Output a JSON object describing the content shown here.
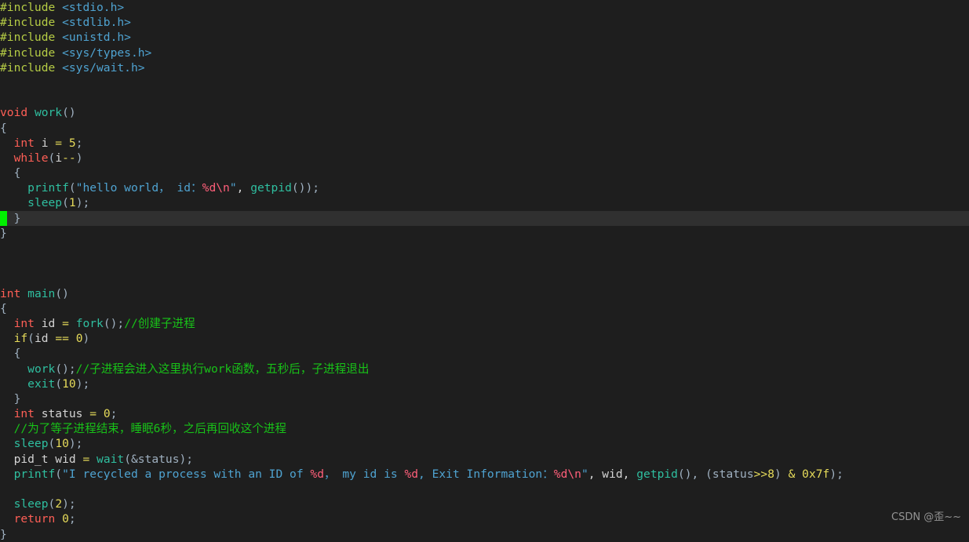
{
  "editor": {
    "background": "#1e1e1e",
    "current_line_background": "#303030",
    "cursor_color": "#00f000",
    "cursor_line_index": 14,
    "cursor_column": 0
  },
  "watermark": {
    "text": "CSDN @歪~~"
  },
  "code": {
    "language": "c",
    "lines": [
      {
        "n": 1,
        "text": "#include <stdio.h>"
      },
      {
        "n": 2,
        "text": "#include <stdlib.h>"
      },
      {
        "n": 3,
        "text": "#include <unistd.h>"
      },
      {
        "n": 4,
        "text": "#include <sys/types.h>"
      },
      {
        "n": 5,
        "text": "#include <sys/wait.h>"
      },
      {
        "n": 6,
        "text": ""
      },
      {
        "n": 7,
        "text": ""
      },
      {
        "n": 8,
        "text": "void work()"
      },
      {
        "n": 9,
        "text": "{"
      },
      {
        "n": 10,
        "text": "  int i = 5;"
      },
      {
        "n": 11,
        "text": "  while(i--)"
      },
      {
        "n": 12,
        "text": "  {"
      },
      {
        "n": 13,
        "text": "    printf(\"hello world， id：%d\\n\", getpid());"
      },
      {
        "n": 14,
        "text": "    sleep(1);"
      },
      {
        "n": 15,
        "text": "  }"
      },
      {
        "n": 16,
        "text": "}"
      },
      {
        "n": 17,
        "text": ""
      },
      {
        "n": 18,
        "text": ""
      },
      {
        "n": 19,
        "text": ""
      },
      {
        "n": 20,
        "text": "int main()"
      },
      {
        "n": 21,
        "text": "{"
      },
      {
        "n": 22,
        "text": "  int id = fork();//创建子进程"
      },
      {
        "n": 23,
        "text": "  if(id == 0)"
      },
      {
        "n": 24,
        "text": "  {"
      },
      {
        "n": 25,
        "text": "    work();//子进程会进入这里执行work函数，五秒后，子进程退出"
      },
      {
        "n": 26,
        "text": "    exit(10);"
      },
      {
        "n": 27,
        "text": "  }"
      },
      {
        "n": 28,
        "text": "  int status = 0;"
      },
      {
        "n": 29,
        "text": "  //为了等子进程结束，睡眠6秒，之后再回收这个进程"
      },
      {
        "n": 30,
        "text": "  sleep(10);"
      },
      {
        "n": 31,
        "text": "  pid_t wid = wait(&status);"
      },
      {
        "n": 32,
        "text": "  printf(\"I recycled a process with an ID of %d， my id is %d, Exit Information：%d\\n\", wid, getpid(), (status>>8) & 0x7f);"
      },
      {
        "n": 33,
        "text": ""
      },
      {
        "n": 34,
        "text": "  sleep(2);"
      },
      {
        "n": 35,
        "text": "  return 0;"
      },
      {
        "n": 36,
        "text": "}"
      }
    ],
    "tokens": {
      "l1": [
        {
          "t": "#include",
          "c": "pre"
        },
        {
          "t": " ",
          "c": "plain"
        },
        {
          "t": "<stdio.h>",
          "c": "hdr"
        }
      ],
      "l2": [
        {
          "t": "#include",
          "c": "pre"
        },
        {
          "t": " ",
          "c": "plain"
        },
        {
          "t": "<stdlib.h>",
          "c": "hdr"
        }
      ],
      "l3": [
        {
          "t": "#include",
          "c": "pre"
        },
        {
          "t": " ",
          "c": "plain"
        },
        {
          "t": "<unistd.h>",
          "c": "hdr"
        }
      ],
      "l4": [
        {
          "t": "#include",
          "c": "pre"
        },
        {
          "t": " ",
          "c": "plain"
        },
        {
          "t": "<sys/types.h>",
          "c": "hdr"
        }
      ],
      "l5": [
        {
          "t": "#include",
          "c": "pre"
        },
        {
          "t": " ",
          "c": "plain"
        },
        {
          "t": "<sys/wait.h>",
          "c": "hdr"
        }
      ],
      "l6": [],
      "l7": [],
      "l8": [
        {
          "t": "void",
          "c": "kw"
        },
        {
          "t": " ",
          "c": "plain"
        },
        {
          "t": "work",
          "c": "fn"
        },
        {
          "t": "()",
          "c": "punct"
        }
      ],
      "l9": [
        {
          "t": "{",
          "c": "punct"
        }
      ],
      "l10": [
        {
          "t": "  ",
          "c": "plain"
        },
        {
          "t": "int",
          "c": "kw"
        },
        {
          "t": " i ",
          "c": "plain"
        },
        {
          "t": "=",
          "c": "op"
        },
        {
          "t": " ",
          "c": "plain"
        },
        {
          "t": "5",
          "c": "num"
        },
        {
          "t": ";",
          "c": "punct"
        }
      ],
      "l11": [
        {
          "t": "  ",
          "c": "plain"
        },
        {
          "t": "while",
          "c": "kw"
        },
        {
          "t": "(",
          "c": "punct"
        },
        {
          "t": "i",
          "c": "plain"
        },
        {
          "t": "--",
          "c": "op"
        },
        {
          "t": ")",
          "c": "punct"
        }
      ],
      "l12": [
        {
          "t": "  ",
          "c": "plain"
        },
        {
          "t": "{",
          "c": "punct"
        }
      ],
      "l13": [
        {
          "t": "    ",
          "c": "plain"
        },
        {
          "t": "printf",
          "c": "fn"
        },
        {
          "t": "(",
          "c": "punct"
        },
        {
          "t": "\"hello world， id：",
          "c": "str"
        },
        {
          "t": "%d",
          "c": "esc"
        },
        {
          "t": "\\n",
          "c": "esc"
        },
        {
          "t": "\"",
          "c": "str"
        },
        {
          "t": ", ",
          "c": "plain"
        },
        {
          "t": "getpid",
          "c": "fn"
        },
        {
          "t": "());",
          "c": "punct"
        }
      ],
      "l14": [
        {
          "t": "    ",
          "c": "plain"
        },
        {
          "t": "sleep",
          "c": "fn"
        },
        {
          "t": "(",
          "c": "punct"
        },
        {
          "t": "1",
          "c": "num"
        },
        {
          "t": ");",
          "c": "punct"
        }
      ],
      "l15": [
        {
          "t": "  ",
          "c": "plain"
        },
        {
          "t": "}",
          "c": "punct"
        }
      ],
      "l16": [
        {
          "t": "}",
          "c": "punct"
        }
      ],
      "l17": [],
      "l18": [],
      "l19": [],
      "l20": [
        {
          "t": "int",
          "c": "kw"
        },
        {
          "t": " ",
          "c": "plain"
        },
        {
          "t": "main",
          "c": "fn"
        },
        {
          "t": "()",
          "c": "punct"
        }
      ],
      "l21": [
        {
          "t": "{",
          "c": "punct"
        }
      ],
      "l22": [
        {
          "t": "  ",
          "c": "plain"
        },
        {
          "t": "int",
          "c": "kw"
        },
        {
          "t": " id ",
          "c": "plain"
        },
        {
          "t": "=",
          "c": "op"
        },
        {
          "t": " ",
          "c": "plain"
        },
        {
          "t": "fork",
          "c": "fn"
        },
        {
          "t": "();",
          "c": "punct"
        },
        {
          "t": "//创建子进程",
          "c": "cmt"
        }
      ],
      "l23": [
        {
          "t": "  ",
          "c": "plain"
        },
        {
          "t": "if",
          "c": "ctrl"
        },
        {
          "t": "(",
          "c": "punct"
        },
        {
          "t": "id ",
          "c": "plain"
        },
        {
          "t": "==",
          "c": "op"
        },
        {
          "t": " ",
          "c": "plain"
        },
        {
          "t": "0",
          "c": "num"
        },
        {
          "t": ")",
          "c": "punct"
        }
      ],
      "l24": [
        {
          "t": "  ",
          "c": "plain"
        },
        {
          "t": "{",
          "c": "punct"
        }
      ],
      "l25": [
        {
          "t": "    ",
          "c": "plain"
        },
        {
          "t": "work",
          "c": "fn"
        },
        {
          "t": "();",
          "c": "punct"
        },
        {
          "t": "//子进程会进入这里执行work函数，五秒后，子进程退出",
          "c": "cmt"
        }
      ],
      "l26": [
        {
          "t": "    ",
          "c": "plain"
        },
        {
          "t": "exit",
          "c": "fn"
        },
        {
          "t": "(",
          "c": "punct"
        },
        {
          "t": "10",
          "c": "num"
        },
        {
          "t": ");",
          "c": "punct"
        }
      ],
      "l27": [
        {
          "t": "  ",
          "c": "plain"
        },
        {
          "t": "}",
          "c": "punct"
        }
      ],
      "l28": [
        {
          "t": "  ",
          "c": "plain"
        },
        {
          "t": "int",
          "c": "kw"
        },
        {
          "t": " status ",
          "c": "plain"
        },
        {
          "t": "=",
          "c": "op"
        },
        {
          "t": " ",
          "c": "plain"
        },
        {
          "t": "0",
          "c": "num"
        },
        {
          "t": ";",
          "c": "punct"
        }
      ],
      "l29": [
        {
          "t": "  ",
          "c": "plain"
        },
        {
          "t": "//为了等子进程结束，睡眠6秒，之后再回收这个进程",
          "c": "cmt"
        }
      ],
      "l30": [
        {
          "t": "  ",
          "c": "plain"
        },
        {
          "t": "sleep",
          "c": "fn"
        },
        {
          "t": "(",
          "c": "punct"
        },
        {
          "t": "10",
          "c": "num"
        },
        {
          "t": ");",
          "c": "punct"
        }
      ],
      "l31": [
        {
          "t": "  pid_t wid ",
          "c": "plain"
        },
        {
          "t": "=",
          "c": "op"
        },
        {
          "t": " ",
          "c": "plain"
        },
        {
          "t": "wait",
          "c": "fn"
        },
        {
          "t": "(&status);",
          "c": "punct"
        }
      ],
      "l32": [
        {
          "t": "  ",
          "c": "plain"
        },
        {
          "t": "printf",
          "c": "fn"
        },
        {
          "t": "(",
          "c": "punct"
        },
        {
          "t": "\"I recycled a process with an ID of ",
          "c": "str"
        },
        {
          "t": "%d",
          "c": "esc"
        },
        {
          "t": "， my id is ",
          "c": "str"
        },
        {
          "t": "%d",
          "c": "esc"
        },
        {
          "t": ", Exit Information：",
          "c": "str"
        },
        {
          "t": "%d",
          "c": "esc"
        },
        {
          "t": "\\n",
          "c": "esc"
        },
        {
          "t": "\"",
          "c": "str"
        },
        {
          "t": ", wid, ",
          "c": "plain"
        },
        {
          "t": "getpid",
          "c": "fn"
        },
        {
          "t": "(), (status",
          "c": "punct"
        },
        {
          "t": ">>",
          "c": "op"
        },
        {
          "t": "8",
          "c": "num"
        },
        {
          "t": ") ",
          "c": "punct"
        },
        {
          "t": "&",
          "c": "op"
        },
        {
          "t": " ",
          "c": "plain"
        },
        {
          "t": "0x7f",
          "c": "num"
        },
        {
          "t": ");",
          "c": "punct"
        }
      ],
      "l33": [],
      "l34": [
        {
          "t": "  ",
          "c": "plain"
        },
        {
          "t": "sleep",
          "c": "fn"
        },
        {
          "t": "(",
          "c": "punct"
        },
        {
          "t": "2",
          "c": "num"
        },
        {
          "t": ");",
          "c": "punct"
        }
      ],
      "l35": [
        {
          "t": "  ",
          "c": "plain"
        },
        {
          "t": "return",
          "c": "kw"
        },
        {
          "t": " ",
          "c": "plain"
        },
        {
          "t": "0",
          "c": "num"
        },
        {
          "t": ";",
          "c": "punct"
        }
      ],
      "l36": [
        {
          "t": "}",
          "c": "punct"
        }
      ]
    }
  }
}
